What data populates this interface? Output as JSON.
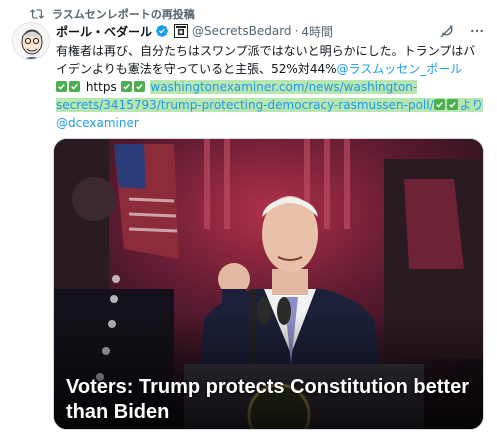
{
  "repost": {
    "label": "ラスムセンレポートの再投稿"
  },
  "author": {
    "display_name": "ポール・ベダール",
    "handle": "@SecretsBedard",
    "separator": "·",
    "time": "4時間"
  },
  "icons": [
    "repost-icon",
    "verified-icon",
    "flag-icon",
    "grok-icon",
    "more-icon",
    "check-emoji-icon"
  ],
  "body": {
    "line1_text": "有権者は再び、自分たちはスワンプ派ではないと明らかにした。トランプはバイデンよりも憲法を守っていると主張、52%対44%",
    "mention": "@ラスムッセン_ポール",
    "https_label": "https",
    "url_line1": "washingtonexaminer.com/news/washington-",
    "url_line2": "secrets/3415793/trump-protecting-democracy-rasmussen-poll/",
    "yori": "より",
    "source_mention": "@dcexaminer"
  },
  "card": {
    "title": "Voters: Trump protects Constitution better than Biden"
  },
  "colors": {
    "link": "#1d9bf0",
    "highlight": "#b8e6b0",
    "secondary_text": "#536471",
    "check_emoji": "#4caf50"
  }
}
